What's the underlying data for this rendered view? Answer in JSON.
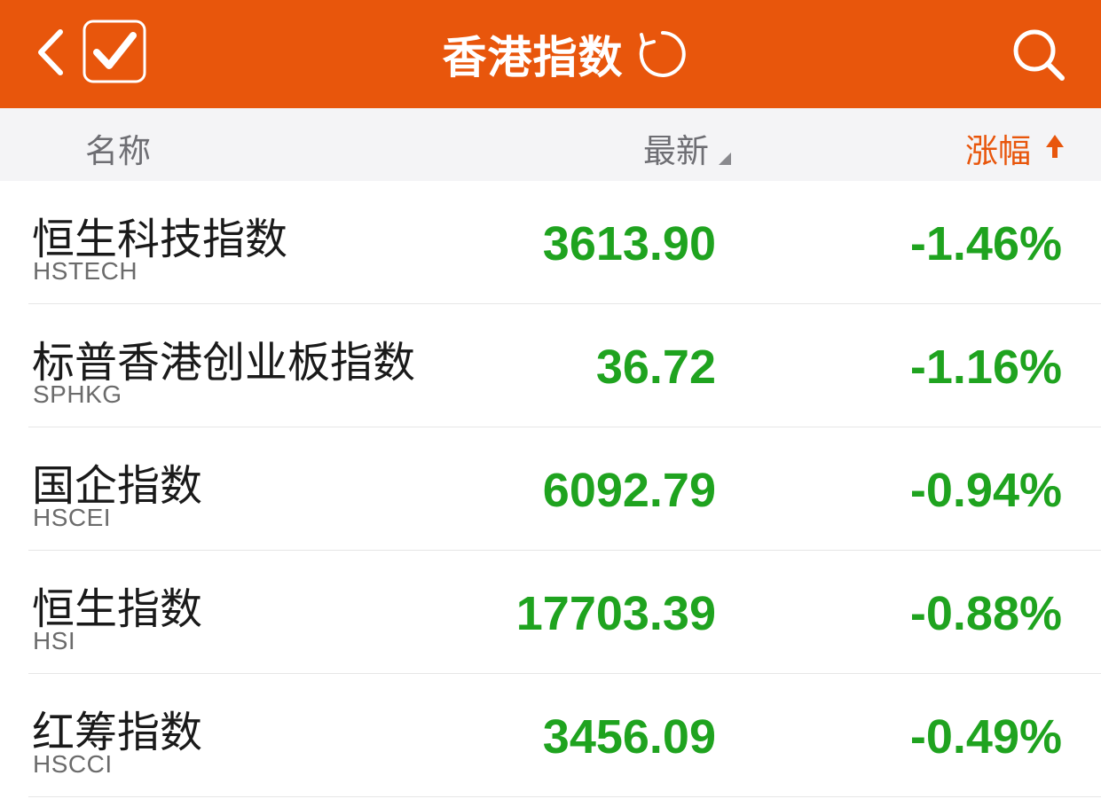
{
  "header": {
    "title": "香港指数",
    "back_icon": "chevron-left-icon",
    "check_icon": "checkbox-checked-icon",
    "refresh_icon": "refresh-icon",
    "search_icon": "search-icon",
    "background_color": "#e8560c"
  },
  "columns": {
    "name": "名称",
    "latest": "最新",
    "change": "涨幅",
    "change_sort_icon": "arrow-up-icon",
    "latest_sort_icon": "sort-triangle-icon",
    "active_sort_color": "#e8560c"
  },
  "rows": [
    {
      "name": "恒生科技指数",
      "code": "HSTECH",
      "price": "3613.90",
      "change": "-1.46%"
    },
    {
      "name": "标普香港创业板指数",
      "code": "SPHKG",
      "price": "36.72",
      "change": "-1.16%"
    },
    {
      "name": "国企指数",
      "code": "HSCEI",
      "price": "6092.79",
      "change": "-0.94%"
    },
    {
      "name": "恒生指数",
      "code": "HSI",
      "price": "17703.39",
      "change": "-0.88%"
    },
    {
      "name": "红筹指数",
      "code": "HSCCI",
      "price": "3456.09",
      "change": "-0.49%"
    }
  ],
  "colors": {
    "down": "#1fa31f"
  }
}
